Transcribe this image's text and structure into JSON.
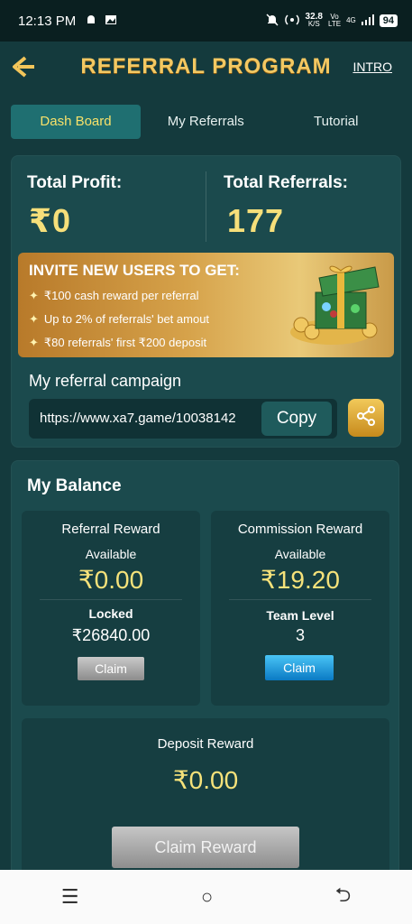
{
  "status_bar": {
    "time": "12:13 PM",
    "speed_value": "32.8",
    "speed_unit": "K/S",
    "net_top": "Vo",
    "net_bottom": "LTE",
    "net2_top": "4G",
    "battery": "94"
  },
  "header": {
    "title": "REFERRAL PROGRAM",
    "intro_label": "INTRO"
  },
  "tabs": [
    {
      "label": "Dash Board"
    },
    {
      "label": "My Referrals"
    },
    {
      "label": "Tutorial"
    }
  ],
  "summary": {
    "profit_label": "Total Profit:",
    "profit_value": "₹0",
    "referrals_label": "Total Referrals:",
    "referrals_value": "177"
  },
  "banner": {
    "title": "INVITE NEW USERS TO GET:",
    "items": [
      "₹100  cash reward per referral",
      "Up to 2% of referrals' bet amout",
      "₹80 referrals' first ₹200 deposit"
    ]
  },
  "campaign": {
    "label": "My referral campaign",
    "url": "https://www.xa7.game/10038142",
    "copy_label": "Copy"
  },
  "balance": {
    "title": "My Balance",
    "referral": {
      "title": "Referral Reward",
      "available_label": "Available",
      "available_value": "₹0.00",
      "locked_label": "Locked",
      "locked_value": "₹26840.00",
      "claim_label": "Claim"
    },
    "commission": {
      "title": "Commission Reward",
      "available_label": "Available",
      "available_value": "₹19.20",
      "team_label": "Team Level",
      "team_value": "3",
      "claim_label": "Claim"
    },
    "deposit": {
      "title": "Deposit Reward",
      "value": "₹0.00",
      "claim_label": "Claim Reward"
    }
  },
  "navbar": {
    "menu_glyph": "☰",
    "home_glyph": "○",
    "back_glyph": "⮌"
  }
}
